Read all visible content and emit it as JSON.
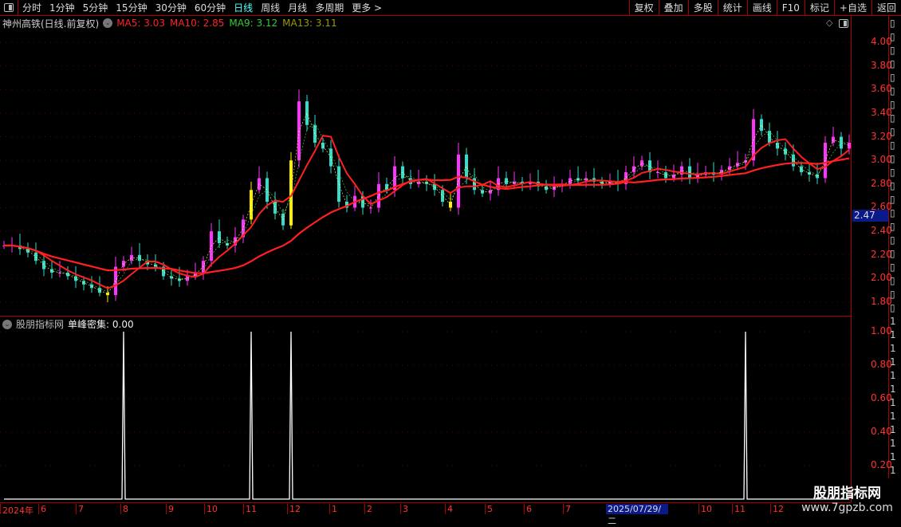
{
  "topbar": {
    "periods": [
      "分时",
      "1分钟",
      "5分钟",
      "15分钟",
      "30分钟",
      "60分钟",
      "日线",
      "周线",
      "月线",
      "多周期",
      "更多 >"
    ],
    "active": "日线",
    "right_buttons": [
      "复权",
      "叠加",
      "多股",
      "统计",
      "画线",
      "F10",
      "标记",
      "+自选",
      "返回"
    ]
  },
  "main": {
    "title": "神州高铁(日线.前复权)",
    "ma": [
      {
        "label": "MA5: 3.03",
        "color": "#ff2222"
      },
      {
        "label": "MA10: 2.85",
        "color": "#ff2222"
      },
      {
        "label": "MA9: 3.12",
        "color": "#33cc33"
      },
      {
        "label": "MA13: 3.11",
        "color": "#999900"
      }
    ],
    "y_ticks": [
      "4.00",
      "3.80",
      "3.60",
      "3.40",
      "3.20",
      "3.00",
      "2.80",
      "2.60",
      "2.40",
      "2.20",
      "2.00",
      "1.80"
    ],
    "current_price": "2.47"
  },
  "indicator": {
    "source": "股朋指标网",
    "name": "单峰密集: 0.00",
    "y_ticks": [
      "1.00",
      "0.80",
      "0.60",
      "0.40",
      "0.20"
    ]
  },
  "x_axis": {
    "labels": [
      "2024年",
      "6",
      "7",
      "8",
      "9",
      "10",
      "11",
      "12",
      "1",
      "2",
      "3",
      "4",
      "5",
      "6",
      "7",
      "10",
      "11",
      "12"
    ],
    "cursor_date": "2025/07/29/二"
  },
  "watermark": {
    "name": "股朋指标网",
    "url": "www.7gpzb.com"
  },
  "colors": {
    "up": "#ff33ff",
    "down": "#33ddcc",
    "signal": "#ffee00",
    "ma_long": "#ff2020",
    "axis": "#aa0000"
  },
  "chart_data": {
    "type": "candlestick",
    "y_range": [
      1.8,
      4.0
    ],
    "close": [
      2.28,
      2.28,
      2.25,
      2.22,
      2.15,
      2.08,
      2.05,
      2.05,
      2.02,
      1.98,
      1.95,
      1.92,
      1.88,
      1.86,
      2.1,
      2.15,
      2.2,
      2.15,
      2.12,
      2.1,
      2.02,
      2.0,
      1.98,
      2.02,
      2.05,
      2.15,
      2.4,
      2.3,
      2.28,
      2.35,
      2.5,
      2.75,
      2.85,
      2.65,
      2.55,
      2.45,
      3.0,
      3.5,
      3.3,
      3.15,
      3.1,
      2.95,
      2.65,
      2.6,
      2.7,
      2.6,
      2.6,
      2.8,
      2.75,
      2.95,
      2.85,
      2.8,
      2.82,
      2.8,
      2.75,
      2.65,
      2.6,
      3.05,
      2.85,
      2.75,
      2.72,
      2.75,
      2.85,
      2.8,
      2.82,
      2.8,
      2.82,
      2.78,
      2.75,
      2.78,
      2.8,
      2.85,
      2.83,
      2.85,
      2.82,
      2.8,
      2.82,
      2.8,
      2.9,
      2.95,
      3.0,
      2.9,
      2.9,
      2.85,
      2.88,
      2.95,
      2.85,
      2.88,
      2.9,
      2.88,
      2.92,
      2.95,
      2.98,
      3.0,
      3.35,
      3.25,
      3.15,
      3.1,
      3.05,
      2.95,
      2.9,
      2.88,
      2.85,
      3.15,
      3.2,
      3.1,
      3.15
    ],
    "signal_bars": [
      13,
      31,
      36,
      56
    ],
    "indicator_spikes": [
      15,
      31,
      36,
      93
    ],
    "indicator_range": [
      0,
      1
    ]
  }
}
